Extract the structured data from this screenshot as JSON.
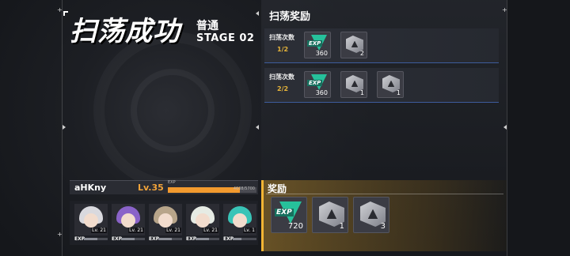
{
  "header": {
    "title": "扫荡成功",
    "difficulty": "普通",
    "stage": "STAGE 02"
  },
  "sweep_rewards": {
    "title": "扫荡奖励",
    "rows": [
      {
        "label": "扫荡次数",
        "count": "1/2",
        "items": [
          {
            "icon": "exp-icon",
            "qty": "360"
          },
          {
            "icon": "material-icon",
            "qty": "2"
          }
        ]
      },
      {
        "label": "扫荡次数",
        "count": "2/2",
        "items": [
          {
            "icon": "exp-icon",
            "qty": "360"
          },
          {
            "icon": "material-icon",
            "qty": "1"
          },
          {
            "icon": "material-icon",
            "qty": "1"
          }
        ]
      }
    ]
  },
  "player": {
    "name": "aHKny",
    "level": "Lv.35",
    "exp_label": "EXP",
    "exp_text": "4608/5700",
    "exp_progress": 0.81
  },
  "characters": [
    {
      "level": "Lv. 21",
      "exp_label": "EXP",
      "exp_progress": 0.55,
      "hair": "#d9d9de"
    },
    {
      "level": "Lv. 21",
      "exp_label": "EXP",
      "exp_progress": 0.55,
      "hair": "#8a63c9"
    },
    {
      "level": "Lv. 21",
      "exp_label": "EXP",
      "exp_progress": 0.55,
      "hair": "#b8a58a"
    },
    {
      "level": "Lv. 21",
      "exp_label": "EXP",
      "exp_progress": 0.55,
      "hair": "#e6ebe4"
    },
    {
      "level": "Lv. 1",
      "exp_label": "EXP",
      "exp_progress": 0.35,
      "hair": "#39c4b7"
    }
  ],
  "total_rewards": {
    "title": "奖励",
    "items": [
      {
        "icon": "exp-icon",
        "qty": "720"
      },
      {
        "icon": "material-icon",
        "qty": "1"
      },
      {
        "icon": "material-icon",
        "qty": "3"
      }
    ]
  },
  "colors": {
    "accent": "#f2b434",
    "exp": "#26c19b",
    "level": "#f2a43b",
    "count": "#e8b53a"
  }
}
